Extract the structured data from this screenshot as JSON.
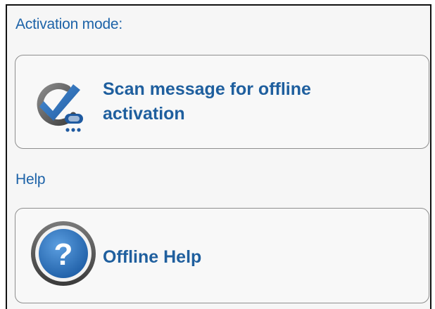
{
  "activation_mode": {
    "heading": "Activation mode:",
    "scan_option": {
      "icon": "checkmark-scanner-icon",
      "label": "Scan message for offline activation"
    }
  },
  "help": {
    "heading": "Help",
    "offline_help": {
      "icon": "help-question-icon",
      "label": "Offline Help"
    }
  },
  "colors": {
    "accent_text": "#1f5f9e",
    "label_text": "#1d63a8",
    "icon_blue": "#2a6db5",
    "icon_gray": "#5a5a5a",
    "card_border": "#8e8e8e"
  }
}
